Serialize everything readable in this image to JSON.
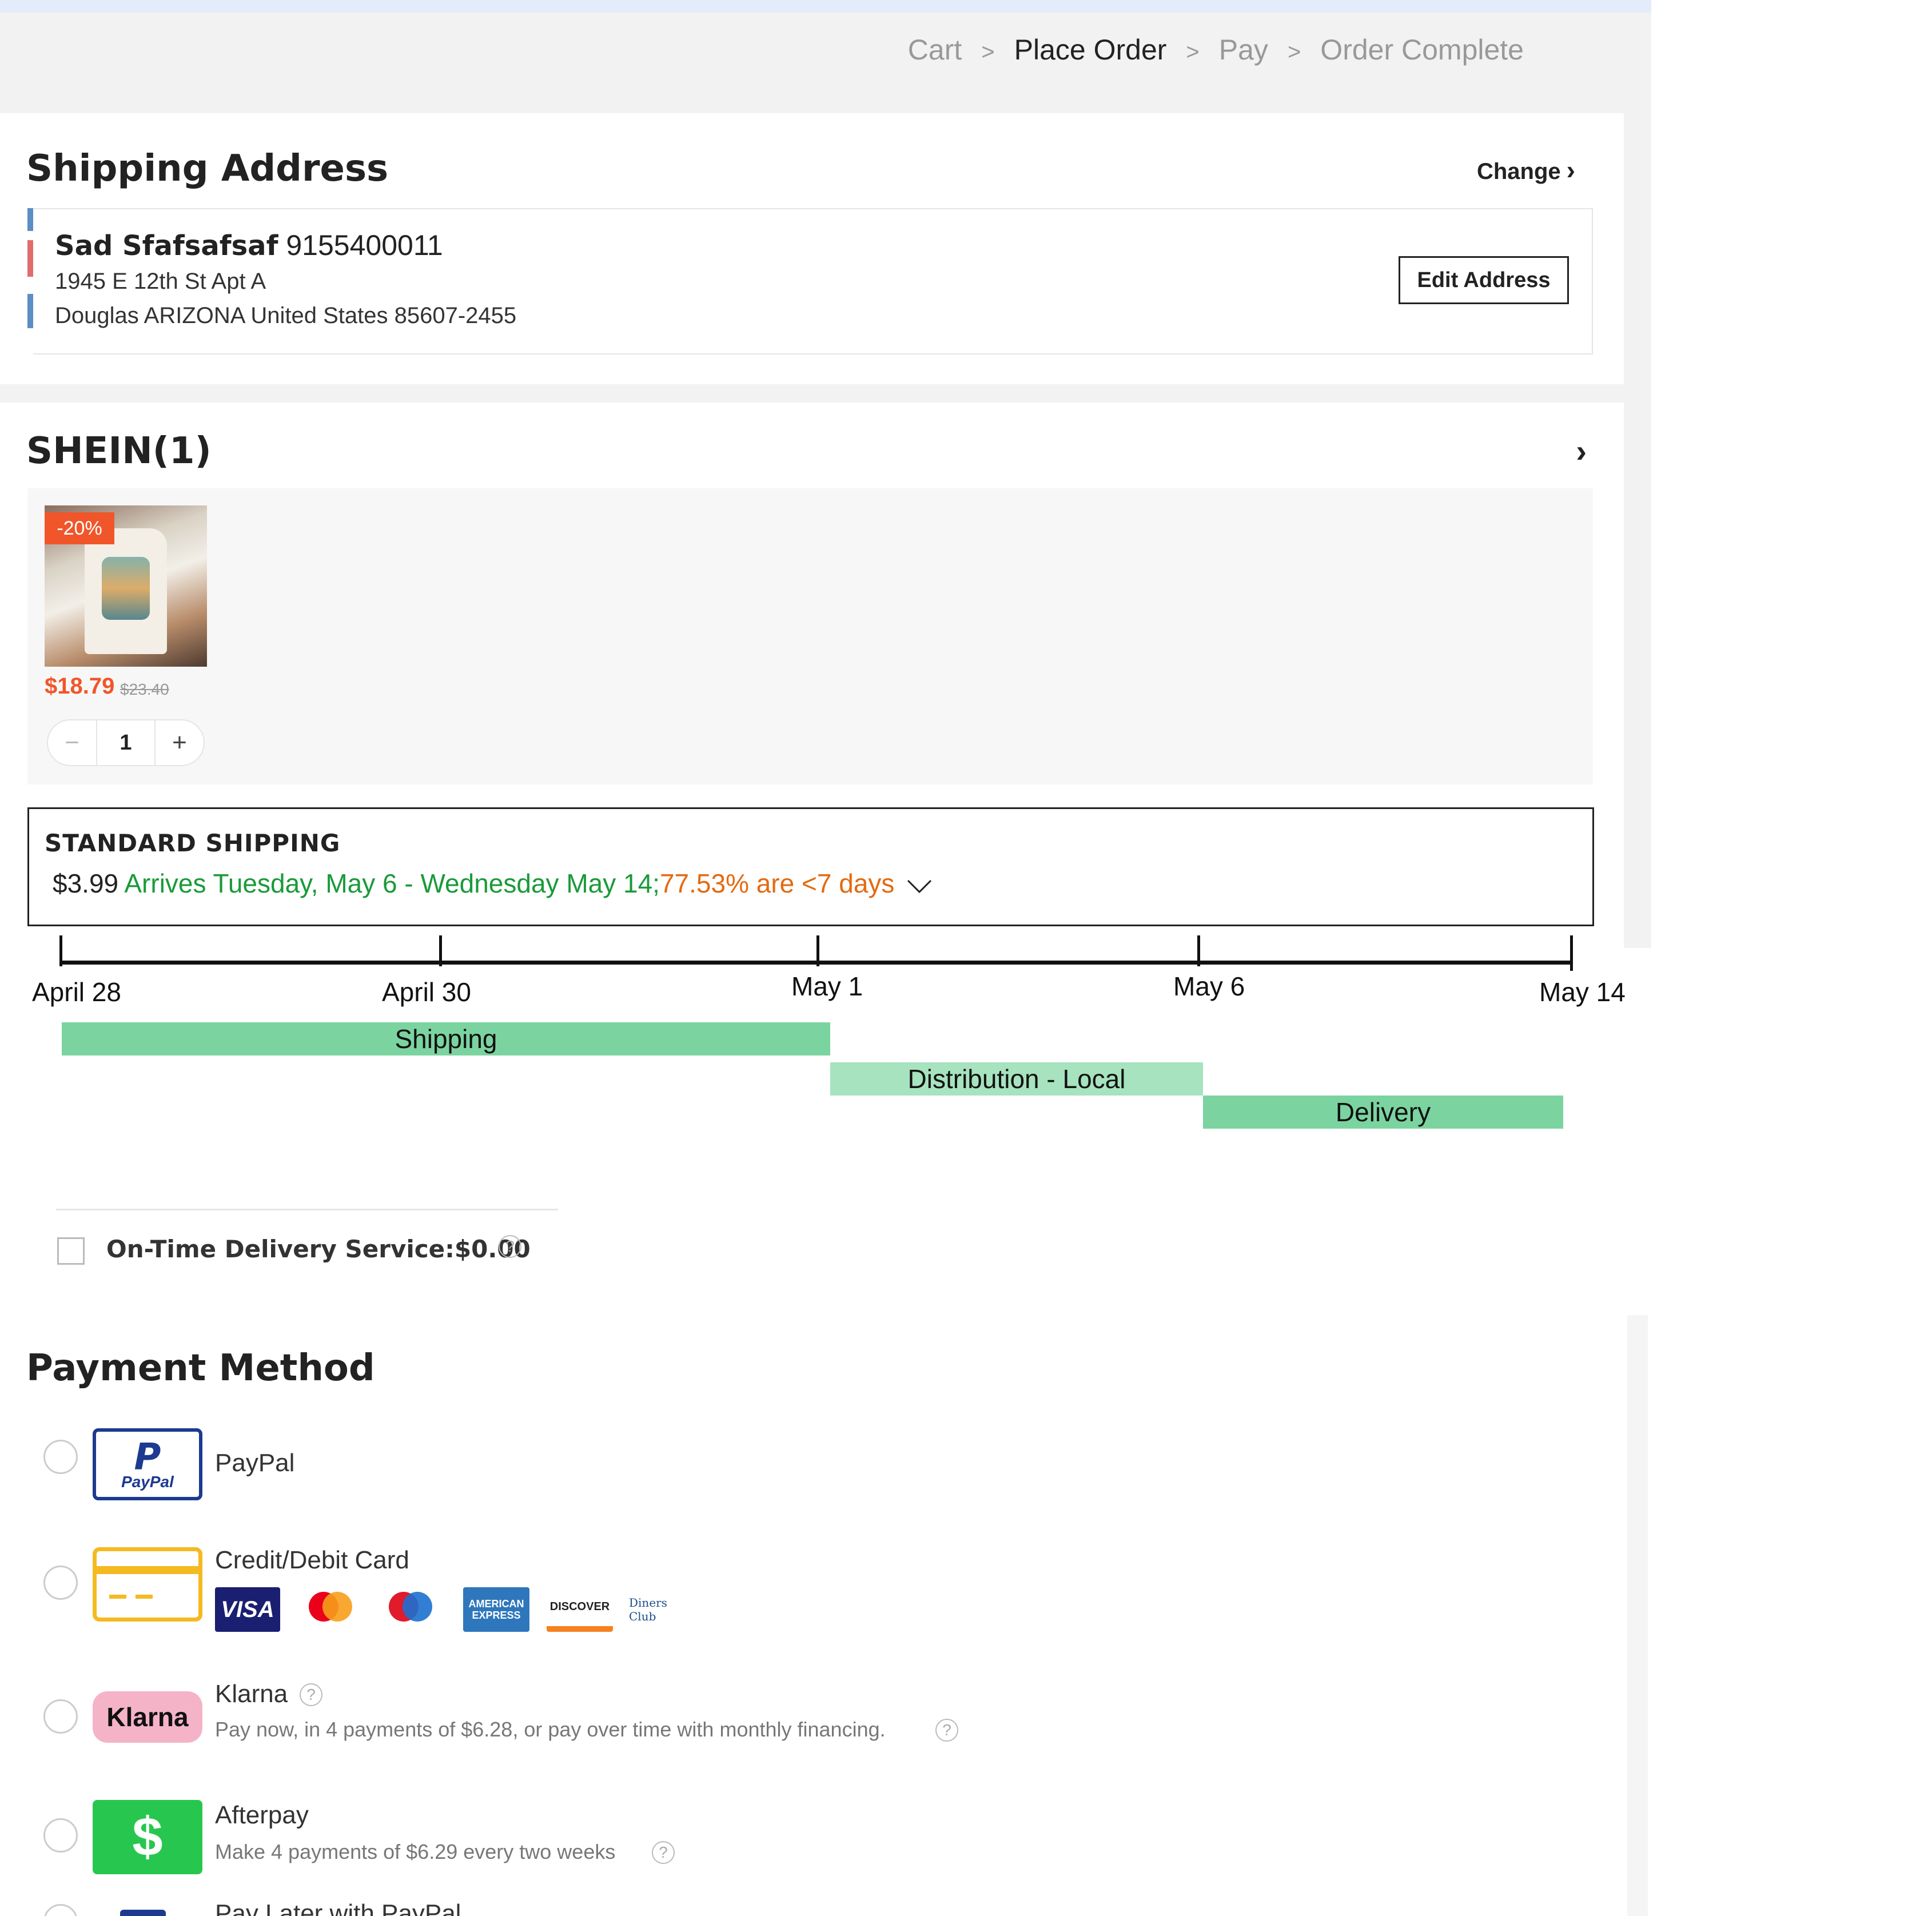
{
  "breadcrumb": [
    "Cart",
    "Place Order",
    "Pay",
    "Order Complete"
  ],
  "breadcrumb_sep": ">",
  "shipping_address": {
    "title": "Shipping Address",
    "change_label": "Change",
    "name": "Sad Sfafsafsaf",
    "phone": "9155400011",
    "line1": "1945 E 12th St Apt A",
    "line2": "Douglas ARIZONA United States 85607-2455",
    "edit_label": "Edit Address"
  },
  "store": {
    "title": "SHEIN(1)",
    "item": {
      "discount": "-20%",
      "price": "$18.79",
      "old_price": "$23.40",
      "quantity": "1",
      "minus": "−",
      "plus": "+"
    }
  },
  "shipping": {
    "method": "STANDARD SHIPPING",
    "price": "$3.99",
    "arrival": "Arrives Tuesday, May 6 - Wednesday May 14;",
    "ontime": "77.53% are <7 days"
  },
  "timeline": {
    "dates": [
      "April 28",
      "April 30",
      "May 1",
      "May 6",
      "May 14"
    ],
    "phases": [
      {
        "label": "Shipping",
        "start": "April 28",
        "end": "May 1",
        "color": "#7bd4a0"
      },
      {
        "label": "Distribution - Local",
        "start": "May 1",
        "end": "May 6",
        "color": "#a6e3be"
      },
      {
        "label": "Delivery",
        "start": "May 6",
        "end": "May 14",
        "color": "#7bd4a0"
      }
    ]
  },
  "ontime_service": {
    "label": "On-Time Delivery Service:$0.00",
    "help": "?"
  },
  "payment": {
    "title": "Payment Method",
    "paypal": {
      "label": "PayPal",
      "logo_text": "PayPal"
    },
    "card": {
      "label": "Credit/Debit Card",
      "brands": [
        "VISA",
        "mastercard",
        "maestro",
        "AMERICAN EXPRESS",
        "DISCOVER",
        "Diners Club"
      ]
    },
    "klarna": {
      "label": "Klarna",
      "logo_text": "Klarna",
      "sub": "Pay now, in 4 payments of $6.28, or pay over time with monthly financing."
    },
    "afterpay": {
      "label": "Afterpay",
      "logo_text": "$",
      "sub": "Make 4 payments of $6.29 every two weeks"
    },
    "paylater": {
      "label": "Pay Later with PayPal"
    }
  },
  "colors": {
    "accent_orange": "#f0562a",
    "arrival_green": "#1a9a3a",
    "ontime_orange": "#e46a10"
  }
}
